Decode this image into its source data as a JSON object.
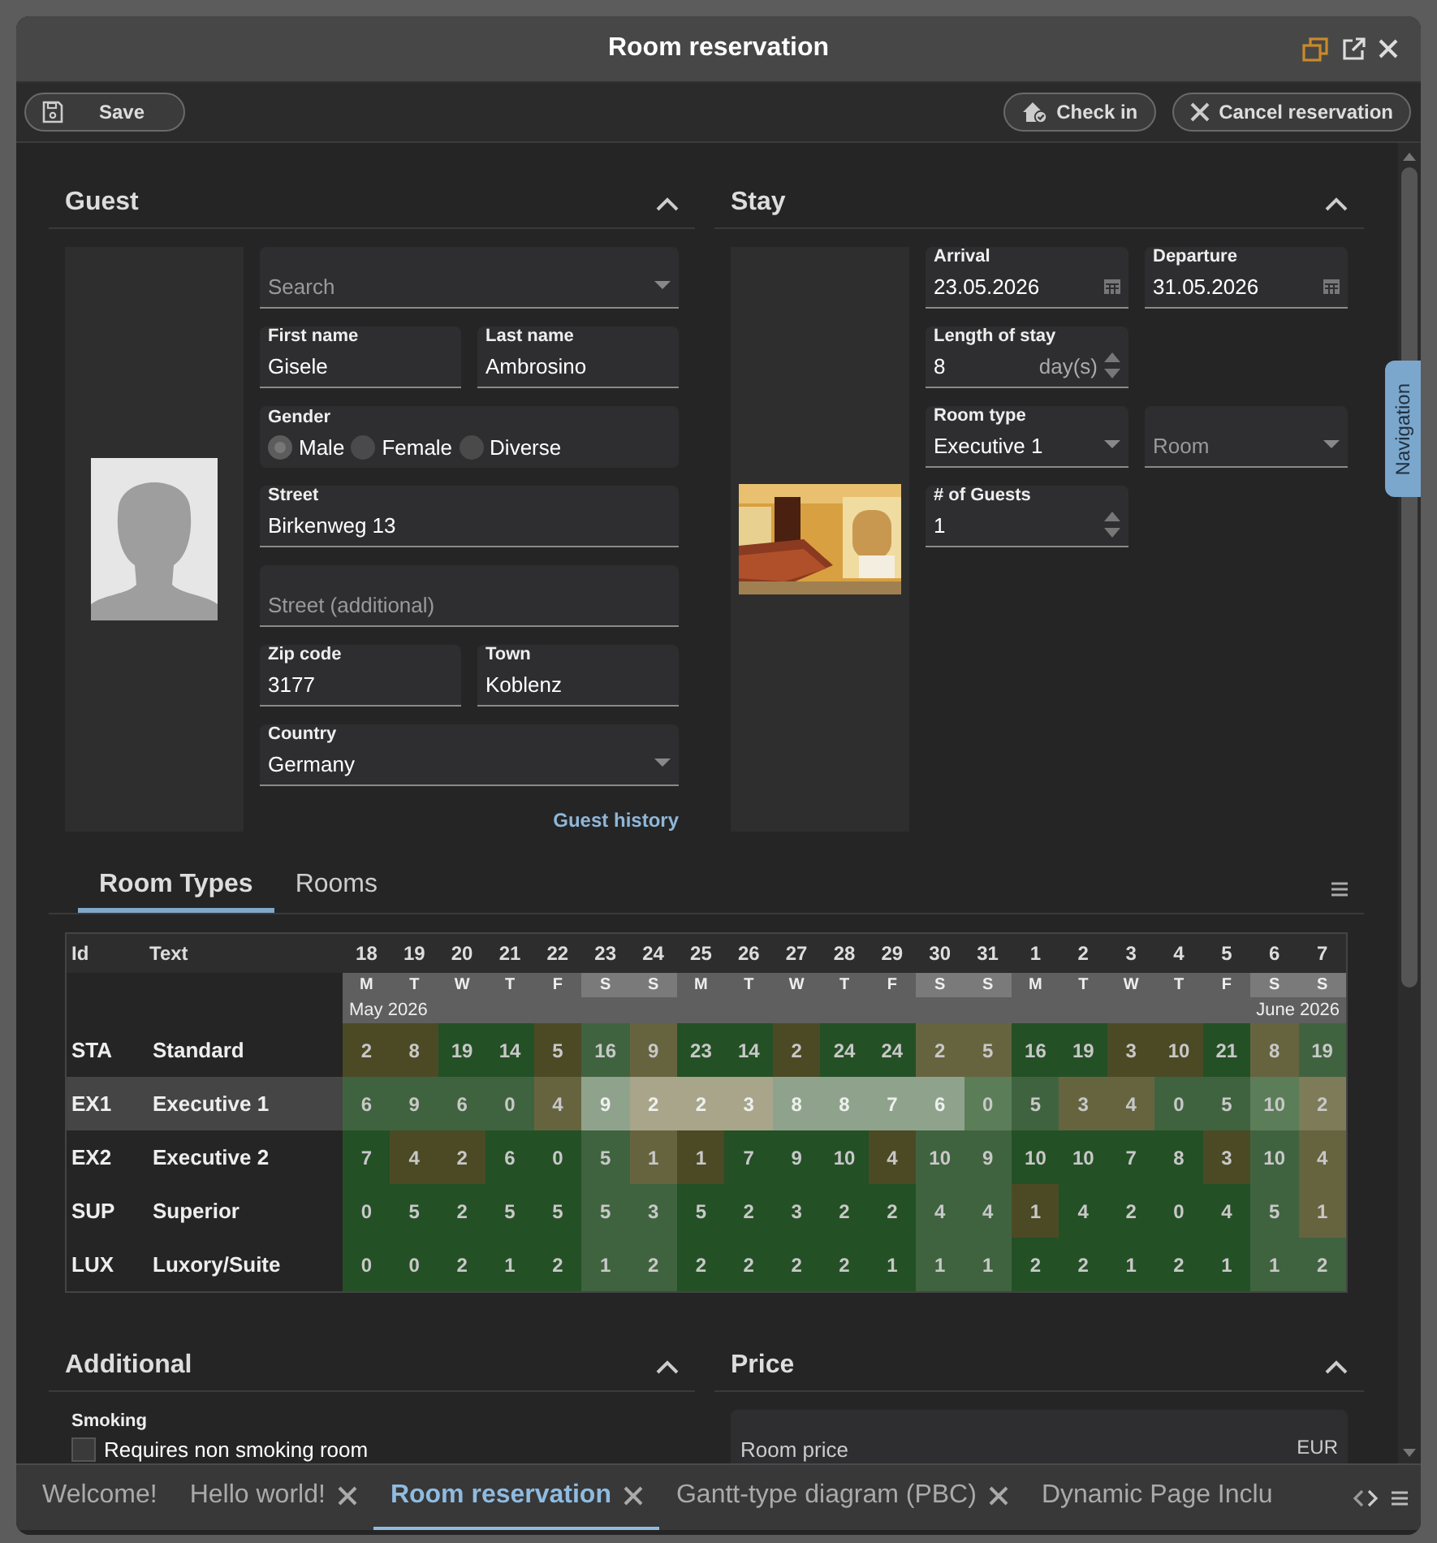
{
  "window": {
    "title": "Room reservation"
  },
  "toolbar": {
    "left": [
      {
        "label": "Save",
        "kind": "save"
      }
    ],
    "right": [
      {
        "label": "Check in",
        "kind": "check_in"
      },
      {
        "label": "Cancel reservation",
        "kind": "cancel"
      }
    ]
  },
  "navigation_tab": {
    "label": "Navigation"
  },
  "guest": {
    "title": "Guest",
    "expanded": true,
    "picture": {
      "kind": "avatar"
    },
    "rows": [
      [
        {
          "kind": "select",
          "placeholder": "Search"
        }
      ],
      [
        {
          "kind": "text",
          "label": "First name",
          "value": "Gisele"
        },
        {
          "kind": "text",
          "label": "Last name",
          "value": "Ambrosino"
        }
      ],
      [
        {
          "kind": "radio",
          "label": "Gender",
          "options": [
            {
              "label": "Male",
              "selected": true
            },
            {
              "label": "Female",
              "selected": false
            },
            {
              "label": "Diverse",
              "selected": false
            }
          ]
        }
      ],
      [
        {
          "kind": "text",
          "label": "Street",
          "value": "Birkenweg 13"
        }
      ],
      [
        {
          "kind": "text",
          "placeholder": "Street (additional)"
        }
      ],
      [
        {
          "kind": "text",
          "label": "Zip code",
          "value": "3177"
        },
        {
          "kind": "text",
          "label": "Town",
          "value": "Koblenz"
        }
      ],
      [
        {
          "kind": "select",
          "label": "Country",
          "value": "Germany"
        }
      ]
    ],
    "link": "Guest history"
  },
  "stay": {
    "title": "Stay",
    "expanded": true,
    "picture": {
      "kind": "picture"
    },
    "rows": [
      [
        {
          "kind": "date",
          "label": "Arrival",
          "value": "23.05.2026"
        },
        {
          "kind": "date",
          "label": "Departure",
          "value": "31.05.2026"
        }
      ],
      [
        {
          "kind": "number",
          "label": "Length of stay",
          "value": "8",
          "unit": "day(s)"
        }
      ],
      [
        {
          "kind": "select",
          "label": "Room type",
          "value": "Executive 1"
        },
        {
          "kind": "select",
          "placeholder": "Room"
        }
      ],
      [
        {
          "kind": "number",
          "label": "# of Guests",
          "value": "1"
        }
      ]
    ]
  },
  "availability": {
    "tabs": [
      {
        "label": "Room Types",
        "selected": true
      },
      {
        "label": "Rooms",
        "selected": false
      }
    ],
    "columns": [
      "Id",
      "Text"
    ],
    "months": [
      "May 2026",
      "June 2026"
    ],
    "days": [
      {
        "day": "18",
        "weekday": "M",
        "weekend": false,
        "in_stay": false
      },
      {
        "day": "19",
        "weekday": "T",
        "weekend": false,
        "in_stay": false
      },
      {
        "day": "20",
        "weekday": "W",
        "weekend": false,
        "in_stay": false
      },
      {
        "day": "21",
        "weekday": "T",
        "weekend": false,
        "in_stay": false
      },
      {
        "day": "22",
        "weekday": "F",
        "weekend": false,
        "in_stay": false
      },
      {
        "day": "23",
        "weekday": "S",
        "weekend": true,
        "in_stay": true
      },
      {
        "day": "24",
        "weekday": "S",
        "weekend": true,
        "in_stay": true
      },
      {
        "day": "25",
        "weekday": "M",
        "weekend": false,
        "in_stay": true
      },
      {
        "day": "26",
        "weekday": "T",
        "weekend": false,
        "in_stay": true
      },
      {
        "day": "27",
        "weekday": "W",
        "weekend": false,
        "in_stay": true
      },
      {
        "day": "28",
        "weekday": "T",
        "weekend": false,
        "in_stay": true
      },
      {
        "day": "29",
        "weekday": "F",
        "weekend": false,
        "in_stay": true
      },
      {
        "day": "30",
        "weekday": "S",
        "weekend": true,
        "in_stay": true
      },
      {
        "day": "31",
        "weekday": "S",
        "weekend": true,
        "in_stay": false
      },
      {
        "day": "1",
        "weekday": "M",
        "weekend": false,
        "in_stay": false
      },
      {
        "day": "2",
        "weekday": "T",
        "weekend": false,
        "in_stay": false
      },
      {
        "day": "3",
        "weekday": "W",
        "weekend": false,
        "in_stay": false
      },
      {
        "day": "4",
        "weekday": "T",
        "weekend": false,
        "in_stay": false
      },
      {
        "day": "5",
        "weekday": "F",
        "weekend": false,
        "in_stay": false
      },
      {
        "day": "6",
        "weekday": "S",
        "weekend": true,
        "in_stay": false
      },
      {
        "day": "7",
        "weekday": "S",
        "weekend": true,
        "in_stay": false
      }
    ],
    "rows": [
      {
        "id": "STA",
        "text": "Standard",
        "selected": false,
        "cells": [
          {
            "value": "2",
            "low": true
          },
          {
            "value": "8",
            "low": true
          },
          {
            "value": "19",
            "low": false
          },
          {
            "value": "14",
            "low": false
          },
          {
            "value": "5",
            "low": true
          },
          {
            "value": "16",
            "low": false
          },
          {
            "value": "9",
            "low": true
          },
          {
            "value": "23",
            "low": false
          },
          {
            "value": "14",
            "low": false
          },
          {
            "value": "2",
            "low": true
          },
          {
            "value": "24",
            "low": false
          },
          {
            "value": "24",
            "low": false
          },
          {
            "value": "2",
            "low": true
          },
          {
            "value": "5",
            "low": true
          },
          {
            "value": "16",
            "low": false
          },
          {
            "value": "19",
            "low": false
          },
          {
            "value": "3",
            "low": true
          },
          {
            "value": "10",
            "low": true
          },
          {
            "value": "21",
            "low": false
          },
          {
            "value": "8",
            "low": true
          },
          {
            "value": "19",
            "low": false
          }
        ]
      },
      {
        "id": "EX1",
        "text": "Executive 1",
        "selected": true,
        "cells": [
          {
            "value": "6",
            "low": false
          },
          {
            "value": "9",
            "low": false
          },
          {
            "value": "6",
            "low": false
          },
          {
            "value": "0",
            "low": false
          },
          {
            "value": "4",
            "low": true
          },
          {
            "value": "9",
            "low": false
          },
          {
            "value": "2",
            "low": true
          },
          {
            "value": "2",
            "low": true
          },
          {
            "value": "3",
            "low": true
          },
          {
            "value": "8",
            "low": false
          },
          {
            "value": "8",
            "low": false
          },
          {
            "value": "7",
            "low": false
          },
          {
            "value": "6",
            "low": false
          },
          {
            "value": "0",
            "low": false
          },
          {
            "value": "5",
            "low": false
          },
          {
            "value": "3",
            "low": true
          },
          {
            "value": "4",
            "low": true
          },
          {
            "value": "0",
            "low": false
          },
          {
            "value": "5",
            "low": false
          },
          {
            "value": "10",
            "low": false
          },
          {
            "value": "2",
            "low": true
          }
        ]
      },
      {
        "id": "EX2",
        "text": "Executive 2",
        "selected": false,
        "cells": [
          {
            "value": "7",
            "low": false
          },
          {
            "value": "4",
            "low": true
          },
          {
            "value": "2",
            "low": true
          },
          {
            "value": "6",
            "low": false
          },
          {
            "value": "0",
            "low": false
          },
          {
            "value": "5",
            "low": false
          },
          {
            "value": "1",
            "low": true
          },
          {
            "value": "1",
            "low": true
          },
          {
            "value": "7",
            "low": false
          },
          {
            "value": "9",
            "low": false
          },
          {
            "value": "10",
            "low": false
          },
          {
            "value": "4",
            "low": true
          },
          {
            "value": "10",
            "low": false
          },
          {
            "value": "9",
            "low": false
          },
          {
            "value": "10",
            "low": false
          },
          {
            "value": "10",
            "low": false
          },
          {
            "value": "7",
            "low": false
          },
          {
            "value": "8",
            "low": false
          },
          {
            "value": "3",
            "low": true
          },
          {
            "value": "10",
            "low": false
          },
          {
            "value": "4",
            "low": true
          }
        ]
      },
      {
        "id": "SUP",
        "text": "Superior",
        "selected": false,
        "cells": [
          {
            "value": "0",
            "low": false
          },
          {
            "value": "5",
            "low": false
          },
          {
            "value": "2",
            "low": false
          },
          {
            "value": "5",
            "low": false
          },
          {
            "value": "5",
            "low": false
          },
          {
            "value": "5",
            "low": false
          },
          {
            "value": "3",
            "low": false
          },
          {
            "value": "5",
            "low": false
          },
          {
            "value": "2",
            "low": false
          },
          {
            "value": "3",
            "low": false
          },
          {
            "value": "2",
            "low": false
          },
          {
            "value": "2",
            "low": false
          },
          {
            "value": "4",
            "low": false
          },
          {
            "value": "4",
            "low": false
          },
          {
            "value": "1",
            "low": true
          },
          {
            "value": "4",
            "low": false
          },
          {
            "value": "2",
            "low": false
          },
          {
            "value": "0",
            "low": false
          },
          {
            "value": "4",
            "low": false
          },
          {
            "value": "5",
            "low": false
          },
          {
            "value": "1",
            "low": true
          }
        ]
      },
      {
        "id": "LUX",
        "text": "Luxory/Suite",
        "selected": false,
        "cells": [
          {
            "value": "0",
            "low": false
          },
          {
            "value": "0",
            "low": false
          },
          {
            "value": "2",
            "low": false
          },
          {
            "value": "1",
            "low": false
          },
          {
            "value": "2",
            "low": false
          },
          {
            "value": "1",
            "low": false
          },
          {
            "value": "2",
            "low": false
          },
          {
            "value": "2",
            "low": false
          },
          {
            "value": "2",
            "low": false
          },
          {
            "value": "2",
            "low": false
          },
          {
            "value": "2",
            "low": false
          },
          {
            "value": "1",
            "low": false
          },
          {
            "value": "1",
            "low": false
          },
          {
            "value": "1",
            "low": false
          },
          {
            "value": "2",
            "low": false
          },
          {
            "value": "2",
            "low": false
          },
          {
            "value": "1",
            "low": false
          },
          {
            "value": "2",
            "low": false
          },
          {
            "value": "1",
            "low": false
          },
          {
            "value": "1",
            "low": false
          },
          {
            "value": "2",
            "low": false
          }
        ]
      }
    ]
  },
  "additional": {
    "title": "Additional",
    "expanded": true,
    "group_label": "Smoking",
    "checkbox": {
      "label": "Requires non smoking room",
      "checked": false
    }
  },
  "price": {
    "title": "Price",
    "expanded": true,
    "field": {
      "label": "Room price",
      "unit": "EUR"
    }
  },
  "document_tabs": [
    {
      "label": "Welcome!",
      "closable": false,
      "selected": false
    },
    {
      "label": "Hello world!",
      "closable": true,
      "selected": false
    },
    {
      "label": "Room reservation",
      "closable": true,
      "selected": true
    },
    {
      "label": "Gantt-type diagram (PBC)",
      "closable": true,
      "selected": false
    },
    {
      "label": "Dynamic Page Inclu",
      "closable": false,
      "selected": false
    }
  ]
}
